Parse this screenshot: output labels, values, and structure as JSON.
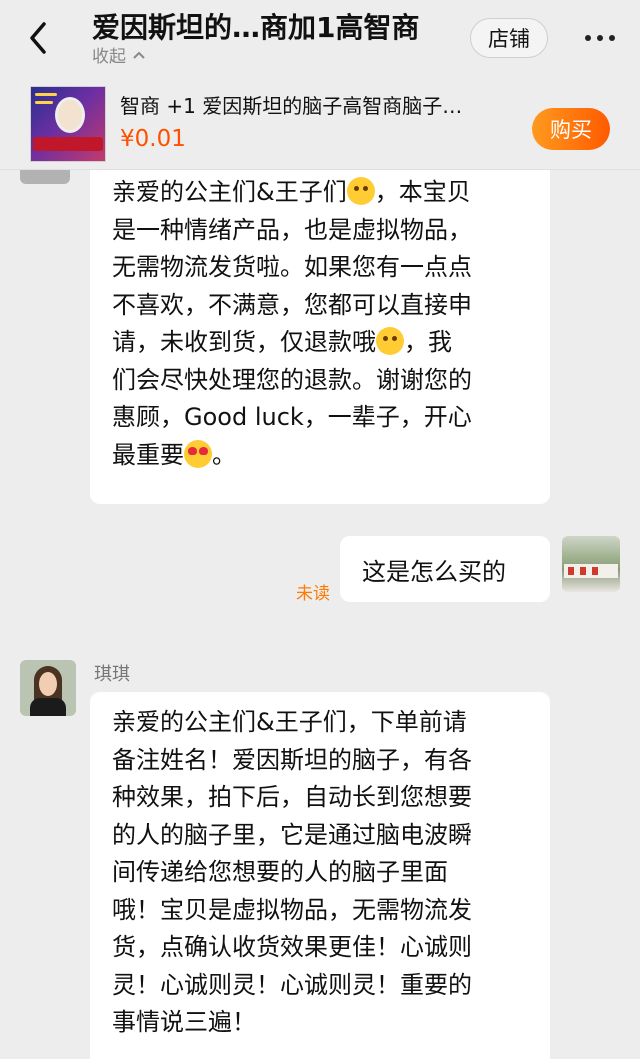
{
  "header": {
    "title": "爱因斯坦的…商加1高智商",
    "collapse_label": "收起",
    "store_button": "店铺",
    "back_icon": "back-chevron-icon",
    "more_icon": "more-dots-icon"
  },
  "product": {
    "name": "智商 +1 爱因斯坦的脑子高智商脑子…",
    "price": "¥0.01",
    "buy_button": "购买",
    "accent_color": "#ff5000"
  },
  "messages": [
    {
      "type": "received",
      "lines": [
        "亲爱的公主们&王子们",
        "，本宝贝",
        "是一种情绪产品，也是虚拟物品，",
        "无需物流发货啦。如果您有一点点",
        "不喜欢，不满意，您都可以直接申",
        "请，未收到货，仅退款哦",
        "，我",
        "们会尽快处理您的退款。谢谢您的",
        "惠顾，Good luck，一辈子，开心",
        "最重要",
        "。"
      ]
    },
    {
      "type": "sent",
      "text": "这是怎么买的",
      "status": "未读"
    },
    {
      "type": "received",
      "sender": "琪琪",
      "lines": [
        "亲爱的公主们&王子们，下单前请",
        "备注姓名！爱因斯坦的脑子，有各",
        "种效果，拍下后，自动长到您想要",
        "的人的脑子里，它是通过脑电波瞬",
        "间传递给您想要的人的脑子里面",
        "哦！宝贝是虚拟物品，无需物流发",
        "货，点确认收货效果更佳！心诚则",
        "灵！心诚则灵！心诚则灵！重要的",
        "事情说三遍！"
      ]
    }
  ]
}
